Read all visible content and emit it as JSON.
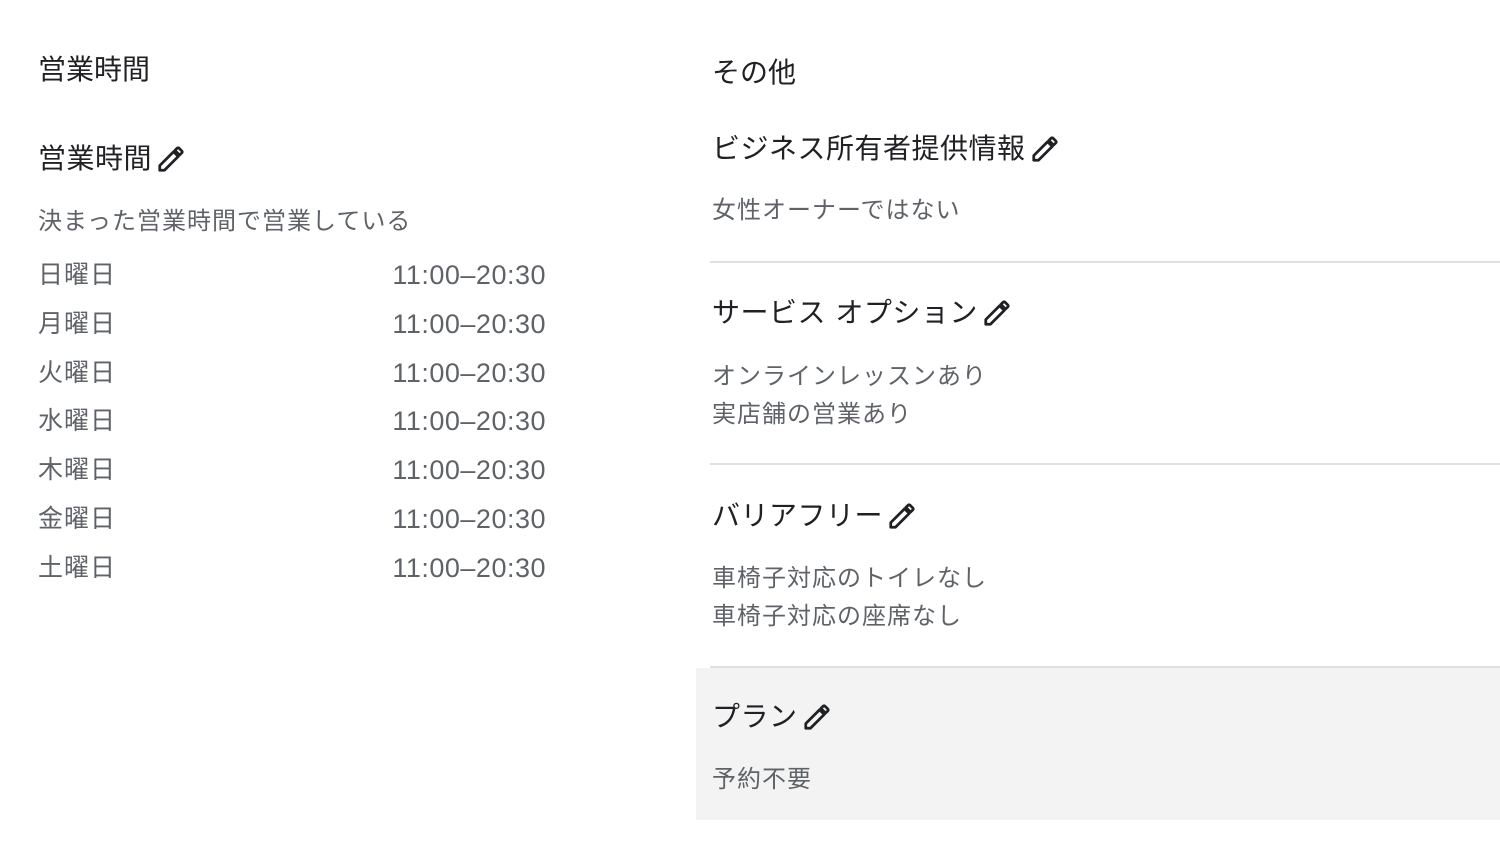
{
  "left": {
    "section_title": "営業時間",
    "hours_subtitle": "営業時間",
    "hours_type": "決まった営業時間で営業している",
    "hours": [
      {
        "day": "日曜日",
        "time": "11:00–20:30"
      },
      {
        "day": "月曜日",
        "time": "11:00–20:30"
      },
      {
        "day": "火曜日",
        "time": "11:00–20:30"
      },
      {
        "day": "水曜日",
        "time": "11:00–20:30"
      },
      {
        "day": "木曜日",
        "time": "11:00–20:30"
      },
      {
        "day": "金曜日",
        "time": "11:00–20:30"
      },
      {
        "day": "土曜日",
        "time": "11:00–20:30"
      }
    ]
  },
  "right": {
    "section_title": "その他",
    "owner_info": {
      "title": "ビジネス所有者提供情報",
      "lines": [
        "女性オーナーではない"
      ]
    },
    "service_options": {
      "title": "サービス オプション",
      "lines": [
        "オンラインレッスンあり",
        "実店舗の営業あり"
      ]
    },
    "accessibility": {
      "title": "バリアフリー",
      "lines": [
        "車椅子対応のトイレなし",
        "車椅子対応の座席なし"
      ]
    },
    "plan": {
      "title": "プラン",
      "lines": [
        "予約不要"
      ]
    }
  },
  "icons": {
    "edit": "pencil-icon"
  },
  "colors": {
    "text_primary": "#202124",
    "text_secondary": "#5f6368",
    "divider": "#e0e0e0",
    "highlight_bg": "#f3f3f3"
  }
}
